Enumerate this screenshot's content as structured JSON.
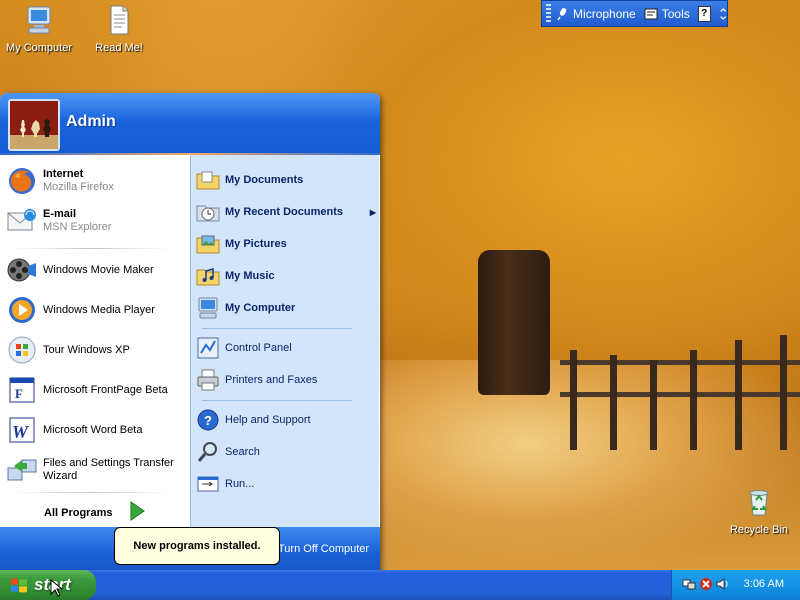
{
  "desktop": {
    "icons": [
      {
        "label": "My Computer"
      },
      {
        "label": "Read Me!"
      },
      {
        "label": "Recycle Bin"
      }
    ]
  },
  "language_bar": {
    "microphone": "Microphone",
    "tools": "Tools",
    "help": "?"
  },
  "start_menu": {
    "user": "Admin",
    "pinned": [
      {
        "title": "Internet",
        "subtitle": "Mozilla Firefox"
      },
      {
        "title": "E-mail",
        "subtitle": "MSN Explorer"
      }
    ],
    "recent": [
      "Windows Movie Maker",
      "Windows Media Player",
      "Tour Windows XP",
      "Microsoft FrontPage Beta",
      "Microsoft Word Beta",
      "Files and Settings Transfer Wizard"
    ],
    "all_programs": "All Programs",
    "places": [
      "My Documents",
      "My Recent Documents",
      "My Pictures",
      "My Music",
      "My Computer"
    ],
    "system": [
      "Control Panel",
      "Printers and Faxes"
    ],
    "tools": [
      "Help and Support",
      "Search",
      "Run..."
    ],
    "turn_off": "Turn Off Computer"
  },
  "balloon": "New programs installed.",
  "taskbar": {
    "start_label": "start",
    "clock": "3:06 AM"
  },
  "colors": {
    "taskbar_blue": "#245edb",
    "start_green": "#3c9a3c",
    "menu_header_blue": "#1a64dc",
    "menu_right_pane": "#d3e5fa"
  }
}
